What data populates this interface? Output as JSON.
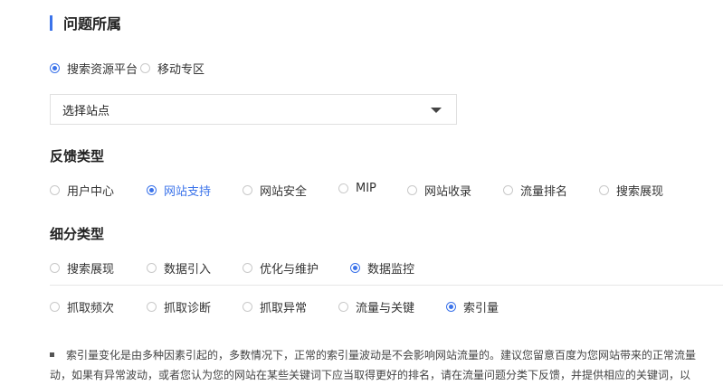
{
  "section_title": "问题所属",
  "platform": {
    "options": [
      "搜索资源平台",
      "移动专区"
    ],
    "selected_index": 0
  },
  "site_select": {
    "value": "选择站点"
  },
  "feedback_type": {
    "heading": "反馈类型",
    "options": [
      "用户中心",
      "网站支持",
      "网站安全",
      "MIP",
      "网站收录",
      "流量排名",
      "搜索展现"
    ],
    "selected_index": 1
  },
  "sub_type": {
    "heading": "细分类型",
    "row1": [
      "搜索展现",
      "数据引入",
      "优化与维护",
      "数据监控"
    ],
    "row1_selected_index": 3,
    "row2": [
      "抓取频次",
      "抓取诊断",
      "抓取异常",
      "流量与关键",
      "索引量"
    ],
    "row2_selected_index": 4
  },
  "note": {
    "line1": "索引量变化是由多种因素引起的，多数情况下，正常的索引量波动是不会影响网站流量的。建议您留意百度为您网站带来的正常流量",
    "line2": "动，如果有异常波动，或者您认为您的网站在某些关键词下应当取得更好的排名，请在流量问题分类下反馈，并提供相应的关键词，以"
  },
  "colors": {
    "accent": "#3b73ea",
    "text": "#333333",
    "border": "#e0e0e0"
  }
}
